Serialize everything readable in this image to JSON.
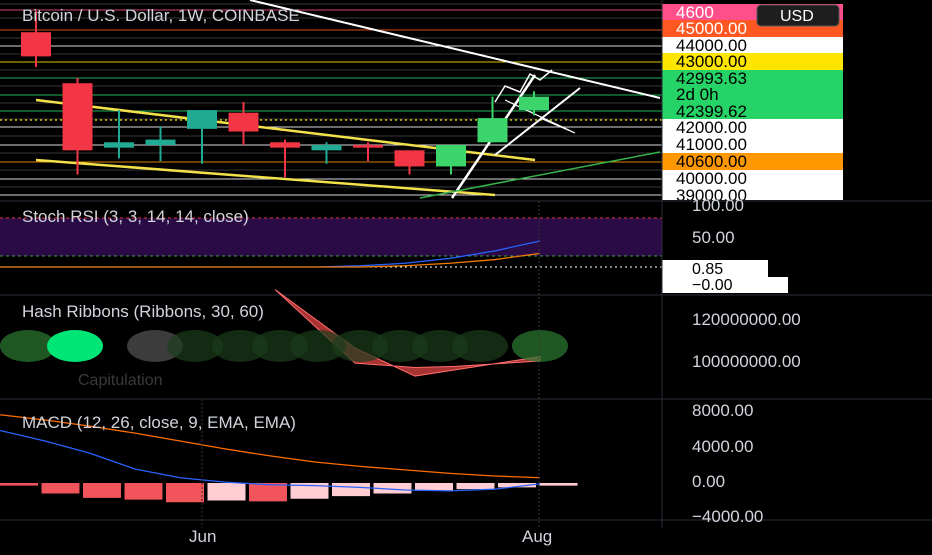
{
  "header": {
    "symbol_title": "Bitcoin / U.S. Dollar, 1W, COINBASE",
    "currency": "USD"
  },
  "colors": {
    "up": "#22ab94",
    "up_bright": "#3cd56b",
    "down": "#f23645",
    "trend_yellow": "#f2e14b",
    "trend_white": "#ffffff",
    "trend_green": "#36b24a",
    "stoch_fill": "#2a0b45",
    "stoch_k": "#2962ff",
    "stoch_d": "#f57c00",
    "hash_ribbon_fill": "#c63c3c",
    "macd_line": "#2962ff",
    "signal_line": "#ff6d00",
    "hist_strong": "#f2545b",
    "hist_weak": "#ffcdd2"
  },
  "price_panel": {
    "labels": [
      {
        "text": "4600",
        "bg": "#ff4f8a",
        "fg": "#ffffff"
      },
      {
        "text": "45000.00",
        "bg": "#ff5722",
        "fg": "#ffffff"
      },
      {
        "text": "44000.00",
        "bg": "#ffffff",
        "fg": "#000000"
      },
      {
        "text": "43000.00",
        "bg": "#ffe600",
        "fg": "#000000"
      },
      {
        "text": "42993.63",
        "bg": "#25d366",
        "fg": "#000000"
      },
      {
        "text": "2d 0h",
        "bg": "#25d366",
        "fg": "#000000"
      },
      {
        "text": "42399.62",
        "bg": "#25d366",
        "fg": "#000000"
      },
      {
        "text": "42000.00",
        "bg": "#ffffff",
        "fg": "#000000"
      },
      {
        "text": "41000.00",
        "bg": "#ffffff",
        "fg": "#000000"
      },
      {
        "text": "40600.00",
        "bg": "#ff9800",
        "fg": "#000000"
      },
      {
        "text": "40000.00",
        "bg": "#ffffff",
        "fg": "#000000"
      },
      {
        "text": "39000.00",
        "bg": "#ffffff",
        "fg": "#000000"
      }
    ]
  },
  "stoch_panel": {
    "title": "Stoch RSI (3, 3, 14, 14, close)",
    "axis_labels": [
      "100.00",
      "50.00"
    ],
    "value_labels": [
      "0.85",
      "−0.00"
    ]
  },
  "hash_panel": {
    "title": "Hash Ribbons (Ribbons, 30, 60)",
    "capitulation_label": "Capitulation",
    "axis_labels": [
      "120000000.00",
      "100000000.00"
    ]
  },
  "macd_panel": {
    "title": "MACD (12, 26, close, 9, EMA, EMA)",
    "axis_labels": [
      "8000.00",
      "4000.00",
      "0.00",
      "−4000.00"
    ]
  },
  "time_axis": {
    "labels": [
      "Jun",
      "Aug"
    ]
  },
  "chart_data": {
    "type": "candlestick",
    "title": "Bitcoin / U.S. Dollar, 1W, COINBASE",
    "candles": [
      {
        "o": 45200,
        "h": 46000,
        "l": 43900,
        "c": 44300
      },
      {
        "o": 43300,
        "h": 43500,
        "l": 39900,
        "c": 40800
      },
      {
        "o": 40900,
        "h": 42300,
        "l": 40500,
        "c": 41100
      },
      {
        "o": 41000,
        "h": 41700,
        "l": 40400,
        "c": 41200
      },
      {
        "o": 41600,
        "h": 42300,
        "l": 40300,
        "c": 42300
      },
      {
        "o": 42200,
        "h": 42600,
        "l": 41000,
        "c": 41500
      },
      {
        "o": 41100,
        "h": 41200,
        "l": 39800,
        "c": 40900
      },
      {
        "o": 40800,
        "h": 41100,
        "l": 40300,
        "c": 41000
      },
      {
        "o": 41000,
        "h": 41100,
        "l": 40400,
        "c": 40900
      },
      {
        "o": 40800,
        "h": 40800,
        "l": 39900,
        "c": 40200
      },
      {
        "o": 40200,
        "h": 41000,
        "l": 39900,
        "c": 41000
      },
      {
        "o": 41100,
        "h": 42800,
        "l": 41100,
        "c": 42000
      },
      {
        "o": 42300,
        "h": 43000,
        "l": 42100,
        "c": 42800
      }
    ],
    "macd_histogram": [
      -300,
      -1200,
      -1700,
      -1900,
      -2200,
      -2000,
      -2100,
      -1800,
      -1500,
      -1200,
      -900,
      -700,
      -500,
      -300
    ],
    "macd_line": [
      6000,
      4800,
      3400,
      1600,
      600,
      100,
      -200,
      -300,
      -500,
      -800,
      -900,
      -700,
      -100
    ],
    "signal_line": [
      7800,
      7200,
      6500,
      5700,
      4800,
      3900,
      3100,
      2400,
      1900,
      1500,
      1100,
      800,
      600
    ],
    "hash_ribbon_upper": [
      107000000,
      106000000,
      105000000,
      104500000,
      104000000
    ],
    "hash_ribbon_lower": [
      123000000,
      112000000,
      101000000,
      100000000,
      102000000
    ],
    "stoch_rsi": {
      "k": [
        0,
        0,
        0,
        0,
        0,
        0,
        0,
        0,
        2,
        6,
        14,
        26,
        42
      ],
      "d": [
        0,
        0,
        0,
        0,
        0,
        0,
        0,
        0,
        0,
        2,
        6,
        12,
        22
      ]
    },
    "x_labels": [
      "Jun",
      "Aug"
    ],
    "grid": false
  }
}
